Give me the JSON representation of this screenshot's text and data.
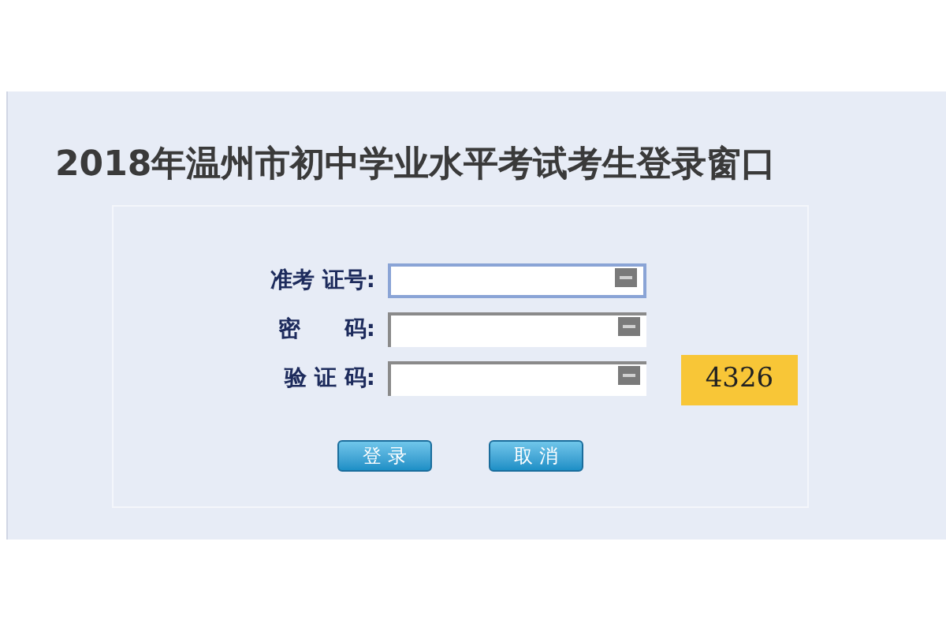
{
  "title": "2018年温州市初中学业水平考试考生登录窗口",
  "fields": [
    {
      "label": "准考 证号:",
      "focused": true
    },
    {
      "label": "密　　码:",
      "focused": false
    },
    {
      "label": "验 证 码:",
      "focused": false
    }
  ],
  "captcha": "4326",
  "buttons": [
    "登 录",
    "取 消"
  ]
}
